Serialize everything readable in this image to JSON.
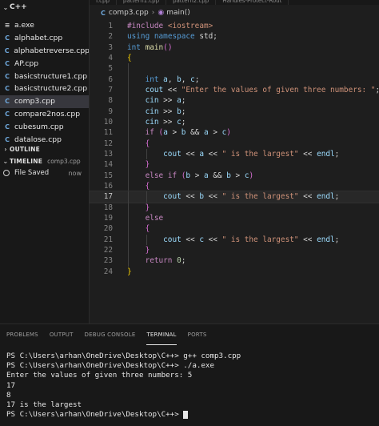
{
  "sidebar": {
    "folder": "C++",
    "files": [
      {
        "name": "a.exe",
        "icon": "exe"
      },
      {
        "name": "alphabet.cpp",
        "icon": "cpp"
      },
      {
        "name": "alphabetreverse.cpp",
        "icon": "cpp"
      },
      {
        "name": "AP.cpp",
        "icon": "cpp"
      },
      {
        "name": "basicstructure1.cpp",
        "icon": "cpp"
      },
      {
        "name": "basicstructure2.cpp",
        "icon": "cpp"
      },
      {
        "name": "comp3.cpp",
        "icon": "cpp",
        "active": true
      },
      {
        "name": "compare2nos.cpp",
        "icon": "cpp"
      },
      {
        "name": "cubesum.cpp",
        "icon": "cpp"
      },
      {
        "name": "datalose.cpp",
        "icon": "cpp"
      }
    ],
    "outline_label": "OUTLINE",
    "timeline_label": "TIMELINE",
    "timeline_file": "comp3.cpp",
    "timeline_item": "File Saved",
    "timeline_time": "now"
  },
  "tabs": [
    "f.cpp",
    "pattern1.cpp",
    "pattern2.cpp",
    "Handles-Protect-Rout"
  ],
  "breadcrumb": {
    "file": "comp3.cpp",
    "symbol": "main()"
  },
  "current_line": 17,
  "code_lines": [
    {
      "n": "1",
      "t": [
        [
          "pp",
          "#include"
        ],
        [
          "def",
          " "
        ],
        [
          "str",
          "<iostream>"
        ]
      ]
    },
    {
      "n": "2",
      "t": [
        [
          "kw",
          "using"
        ],
        [
          "def",
          " "
        ],
        [
          "kw",
          "namespace"
        ],
        [
          "def",
          " "
        ],
        [
          "def",
          "std;"
        ]
      ]
    },
    {
      "n": "3",
      "t": [
        [
          "kw",
          "int"
        ],
        [
          "def",
          " "
        ],
        [
          "fn",
          "main"
        ],
        [
          "p2",
          "()"
        ]
      ]
    },
    {
      "n": "4",
      "t": [
        [
          "p1",
          "{"
        ]
      ]
    },
    {
      "n": "5",
      "t": []
    },
    {
      "n": "6",
      "t": [
        [
          "def",
          "    "
        ],
        [
          "kw",
          "int"
        ],
        [
          "def",
          " "
        ],
        [
          "var",
          "a"
        ],
        [
          "def",
          ", "
        ],
        [
          "var",
          "b"
        ],
        [
          "def",
          ", "
        ],
        [
          "var",
          "c"
        ],
        [
          "def",
          ";"
        ]
      ]
    },
    {
      "n": "7",
      "t": [
        [
          "def",
          "    "
        ],
        [
          "var",
          "cout"
        ],
        [
          "def",
          " << "
        ],
        [
          "str",
          "\"Enter the values of given three numbers: \""
        ],
        [
          "def",
          ";"
        ]
      ]
    },
    {
      "n": "8",
      "t": [
        [
          "def",
          "    "
        ],
        [
          "var",
          "cin"
        ],
        [
          "def",
          " >> "
        ],
        [
          "var",
          "a"
        ],
        [
          "def",
          ";"
        ]
      ]
    },
    {
      "n": "9",
      "t": [
        [
          "def",
          "    "
        ],
        [
          "var",
          "cin"
        ],
        [
          "def",
          " >> "
        ],
        [
          "var",
          "b"
        ],
        [
          "def",
          ";"
        ]
      ]
    },
    {
      "n": "10",
      "t": [
        [
          "def",
          "    "
        ],
        [
          "var",
          "cin"
        ],
        [
          "def",
          " >> "
        ],
        [
          "var",
          "c"
        ],
        [
          "def",
          ";"
        ]
      ]
    },
    {
      "n": "11",
      "t": [
        [
          "def",
          "    "
        ],
        [
          "ctl",
          "if"
        ],
        [
          "def",
          " "
        ],
        [
          "p2",
          "("
        ],
        [
          "var",
          "a"
        ],
        [
          "def",
          " > "
        ],
        [
          "var",
          "b"
        ],
        [
          "def",
          " && "
        ],
        [
          "var",
          "a"
        ],
        [
          "def",
          " > "
        ],
        [
          "var",
          "c"
        ],
        [
          "p2",
          ")"
        ]
      ]
    },
    {
      "n": "12",
      "t": [
        [
          "def",
          "    "
        ],
        [
          "p2",
          "{"
        ]
      ]
    },
    {
      "n": "13",
      "t": [
        [
          "def",
          "        "
        ],
        [
          "var",
          "cout"
        ],
        [
          "def",
          " << "
        ],
        [
          "var",
          "a"
        ],
        [
          "def",
          " << "
        ],
        [
          "str",
          "\" is the largest\""
        ],
        [
          "def",
          " << "
        ],
        [
          "var",
          "endl"
        ],
        [
          "def",
          ";"
        ]
      ]
    },
    {
      "n": "14",
      "t": [
        [
          "def",
          "    "
        ],
        [
          "p2",
          "}"
        ]
      ]
    },
    {
      "n": "15",
      "t": [
        [
          "def",
          "    "
        ],
        [
          "ctl",
          "else"
        ],
        [
          "def",
          " "
        ],
        [
          "ctl",
          "if"
        ],
        [
          "def",
          " "
        ],
        [
          "p2",
          "("
        ],
        [
          "var",
          "b"
        ],
        [
          "def",
          " > "
        ],
        [
          "var",
          "a"
        ],
        [
          "def",
          " && "
        ],
        [
          "var",
          "b"
        ],
        [
          "def",
          " > "
        ],
        [
          "var",
          "c"
        ],
        [
          "p2",
          ")"
        ]
      ]
    },
    {
      "n": "16",
      "t": [
        [
          "def",
          "    "
        ],
        [
          "p2",
          "{"
        ]
      ]
    },
    {
      "n": "17",
      "t": [
        [
          "def",
          "        "
        ],
        [
          "var",
          "cout"
        ],
        [
          "def",
          " << "
        ],
        [
          "var",
          "b"
        ],
        [
          "def",
          " << "
        ],
        [
          "str",
          "\" is the largest\""
        ],
        [
          "def",
          " << "
        ],
        [
          "var",
          "endl"
        ],
        [
          "def",
          ";"
        ]
      ]
    },
    {
      "n": "18",
      "t": [
        [
          "def",
          "    "
        ],
        [
          "p2",
          "}"
        ]
      ]
    },
    {
      "n": "19",
      "t": [
        [
          "def",
          "    "
        ],
        [
          "ctl",
          "else"
        ]
      ]
    },
    {
      "n": "20",
      "t": [
        [
          "def",
          "    "
        ],
        [
          "p2",
          "{"
        ]
      ]
    },
    {
      "n": "21",
      "t": [
        [
          "def",
          "        "
        ],
        [
          "var",
          "cout"
        ],
        [
          "def",
          " << "
        ],
        [
          "var",
          "c"
        ],
        [
          "def",
          " << "
        ],
        [
          "str",
          "\" is the largest\""
        ],
        [
          "def",
          " << "
        ],
        [
          "var",
          "endl"
        ],
        [
          "def",
          ";"
        ]
      ]
    },
    {
      "n": "22",
      "t": [
        [
          "def",
          "    "
        ],
        [
          "p2",
          "}"
        ]
      ]
    },
    {
      "n": "23",
      "t": [
        [
          "def",
          "    "
        ],
        [
          "ctl",
          "return"
        ],
        [
          "def",
          " "
        ],
        [
          "num",
          "0"
        ],
        [
          "def",
          ";"
        ]
      ]
    },
    {
      "n": "24",
      "t": [
        [
          "p1",
          "}"
        ]
      ]
    }
  ],
  "panel": {
    "tabs": [
      "PROBLEMS",
      "OUTPUT",
      "DEBUG CONSOLE",
      "TERMINAL",
      "PORTS"
    ],
    "active_tab": "TERMINAL",
    "terminal_lines": [
      "PS C:\\Users\\arhan\\OneDrive\\Desktop\\C++> g++ comp3.cpp",
      "PS C:\\Users\\arhan\\OneDrive\\Desktop\\C++> ./a.exe",
      "Enter the values of given three numbers: 5",
      "17",
      "8",
      "17 is the largest",
      "PS C:\\Users\\arhan\\OneDrive\\Desktop\\C++> "
    ]
  }
}
